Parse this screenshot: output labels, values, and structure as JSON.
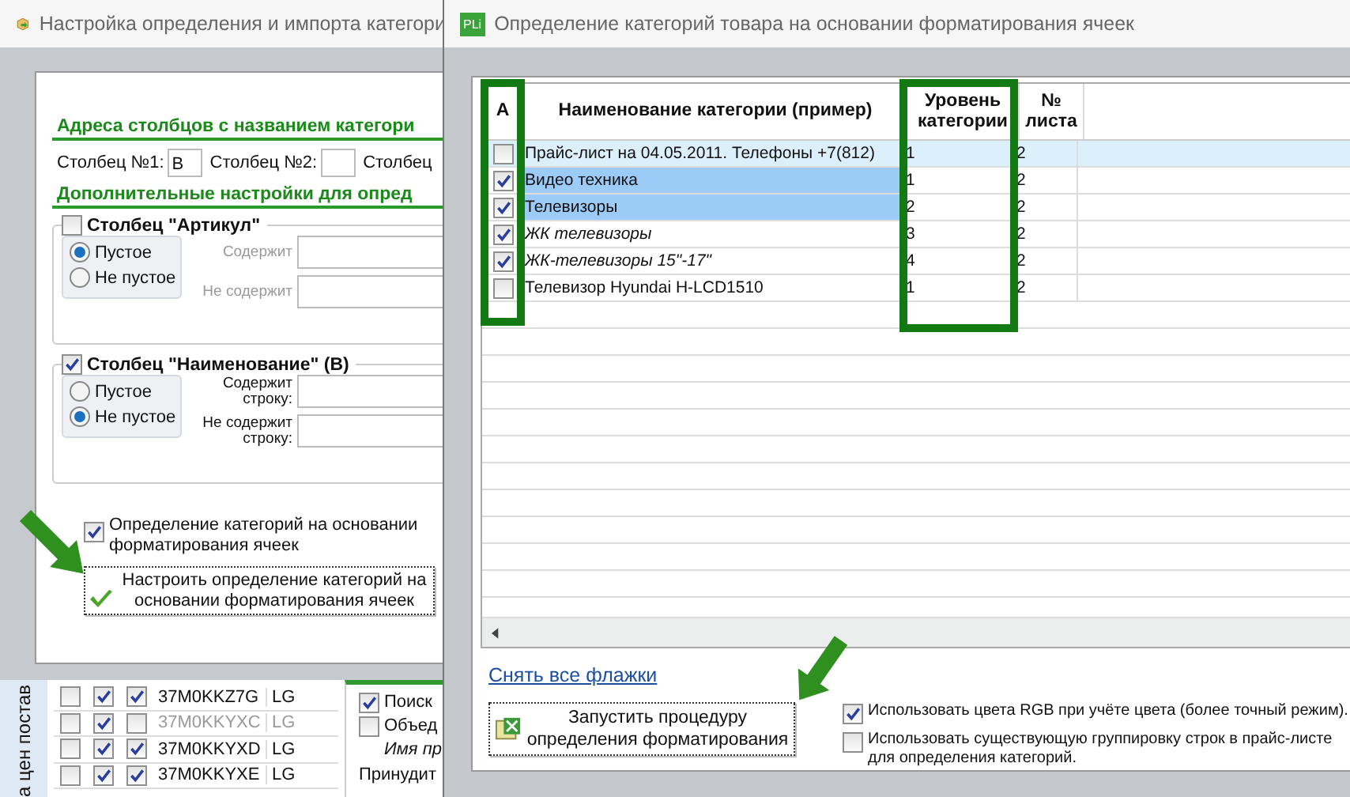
{
  "left_window": {
    "title": "Настройка определения и импорта категори",
    "address_heading": "Адреса столбцов с названием категори",
    "address_fields": [
      {
        "label": "Столбец №1:",
        "value": "B"
      },
      {
        "label": "Столбец №2:"
      },
      {
        "label": "Столбец"
      }
    ],
    "extra_heading": "Дополнительные настройки для опред",
    "groups": [
      {
        "title": "Столбец \"Артикул\"",
        "checked": false,
        "radios": [
          {
            "label": "Пустое",
            "selected": true
          },
          {
            "label": "Не пустое",
            "selected": false
          }
        ],
        "filters": [
          {
            "label": "Содержит"
          },
          {
            "label": "Не содержит"
          }
        ]
      },
      {
        "title": "Столбец \"Наименование\" (B)",
        "checked": true,
        "radios": [
          {
            "label": "Пустое",
            "selected": false
          },
          {
            "label": "Не пустое",
            "selected": true
          }
        ],
        "filters": [
          {
            "label": "Содержит строку:"
          },
          {
            "label": "Не содержит строку:"
          }
        ]
      }
    ],
    "format_checkbox": {
      "label": "Определение категорий на основании форматирования ячеек",
      "checked": true
    },
    "setup_button": "Настроить определение категорий на основании форматирования ячеек"
  },
  "back_window": {
    "side_label": "а цен постав",
    "rows": [
      {
        "checks": [
          false,
          true,
          true
        ],
        "code": "37M0KKZ7G",
        "brand": "LG",
        "disabled": false
      },
      {
        "checks": [
          false,
          true,
          false
        ],
        "code": "37M0KKYXC",
        "brand": "LG",
        "disabled": true
      },
      {
        "checks": [
          false,
          true,
          true
        ],
        "code": "37M0KKYXD",
        "brand": "LG",
        "disabled": false
      },
      {
        "checks": [
          false,
          true,
          true
        ],
        "code": "37M0KKYXE",
        "brand": "LG",
        "disabled": false
      }
    ],
    "options": [
      {
        "label": "Поиск",
        "checked": true
      },
      {
        "label": "Объед",
        "checked": false
      }
    ],
    "note": "Имя пр",
    "last_label": "Принудит"
  },
  "right_window": {
    "title": "Определение категорий товара на основании форматирования ячеек",
    "icon_label": "PLi",
    "columns": [
      "A",
      "Наименование категории (пример)",
      "Уровень категории",
      "№ листа"
    ],
    "rows": [
      {
        "checked": false,
        "name": "Прайс-лист на 04.05.2011. Телефоны +7(812)",
        "level": "1",
        "sheet": "2",
        "selected": true,
        "highlighted": false,
        "italic": false
      },
      {
        "checked": true,
        "name": "Видео техника",
        "level": "1",
        "sheet": "2",
        "selected": false,
        "highlighted": true,
        "italic": false
      },
      {
        "checked": true,
        "name": "Телевизоры",
        "level": "2",
        "sheet": "2",
        "selected": false,
        "highlighted": true,
        "italic": false
      },
      {
        "checked": true,
        "name": "ЖК телевизоры",
        "level": "3",
        "sheet": "2",
        "selected": false,
        "highlighted": false,
        "italic": true
      },
      {
        "checked": true,
        "name": "ЖК-телевизоры 15\"-17\"",
        "level": "4",
        "sheet": "2",
        "selected": false,
        "highlighted": false,
        "italic": true
      },
      {
        "checked": false,
        "name": "Телевизор Hyundai H-LCD1510",
        "level": "1",
        "sheet": "2",
        "selected": false,
        "highlighted": false,
        "italic": false
      }
    ],
    "clear_link": "Снять все флажки",
    "run_button": "Запустить процедуру определения форматирования",
    "options": [
      {
        "label": "Использовать цвета RGB при учёте цвета (более точный режим).",
        "checked": true
      },
      {
        "label": "Использовать существующую группировку строк в прайс-листе для определения категорий.",
        "checked": false
      }
    ]
  }
}
